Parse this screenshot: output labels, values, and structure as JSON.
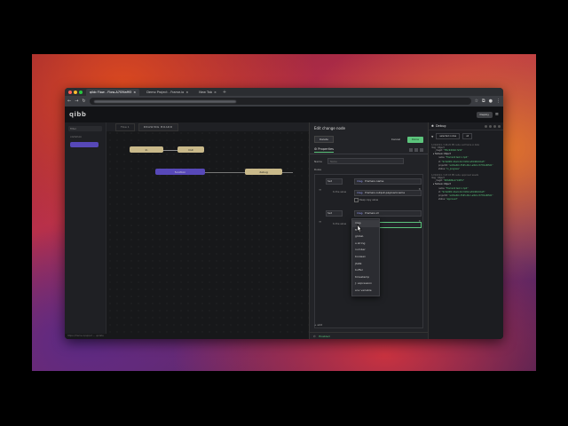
{
  "browser": {
    "tabs": [
      {
        "title": "qibb Flow - Flow-A7S9laf93",
        "active": true
      },
      {
        "title": "Demo Project - Frame.io",
        "active": false
      },
      {
        "title": "New Tab",
        "active": false
      }
    ],
    "new_tab": "+",
    "url": "",
    "traffic_lights": [
      "#ff5f57",
      "#febc2e",
      "#28c840"
    ]
  },
  "app": {
    "logo": "qibb",
    "deploy_label": "Deploy",
    "menu_icon": "hamburger-icon"
  },
  "palette": {
    "search_placeholder": "filter",
    "category": "common"
  },
  "workspace": {
    "tabs": [
      "Flow 1",
      "DRAWING BOARD"
    ],
    "nodes": [
      {
        "label": "In"
      },
      {
        "label": "Out"
      },
      {
        "label": "function"
      },
      {
        "label": "debug"
      }
    ],
    "status": "https://frame.io/api/v2 ... update"
  },
  "editor": {
    "title": "Edit change node",
    "delete_label": "Delete",
    "cancel_label": "Cancel",
    "done_label": "Done",
    "properties_tab": "Properties",
    "name_label": "Name",
    "name_placeholder": "Name",
    "rules_label": "Rules",
    "rules": [
      {
        "action": "Set",
        "property_prefix": "msg.",
        "property": "frameio.name",
        "to_label": "to the value",
        "value_prefix": "msg.",
        "value": "frameio.output.payload.name",
        "deep_copy_label": "Deep copy value"
      },
      {
        "action": "Set",
        "property_prefix": "msg.",
        "property": "frameio.id",
        "to_label": "to the value",
        "value_prefix": "a-z",
        "value": ""
      }
    ],
    "type_options": [
      "msg.",
      "flow.",
      "global.",
      "a string",
      "number",
      "boolean",
      "JSON",
      "buffer",
      "timestamp",
      "J: expression",
      "env variable"
    ],
    "hover_option_index": 0,
    "add_label": "+ add",
    "enabled_label": "Enabled"
  },
  "debug": {
    "title": "Debug",
    "filter_label": "selected nodes",
    "clear_label": "all",
    "messages": [
      {
        "meta": "1/22/2024, 3:46:20 PM  node: set frame.io data",
        "path": "msg : Object",
        "fields": [
          {
            "k": "_msgid",
            "v": "\"f3bc9d04b17a5b\""
          },
          {
            "k": "frameio",
            "v": "Object",
            "obj": true
          },
          {
            "k": "name",
            "v": "\"Frame10 test 1.mp4\""
          },
          {
            "k": "id",
            "v": "\"9c3e908c-4be9-41cf-9dbd-a8146b2cba5\""
          },
          {
            "k": "projectId",
            "v": "\"ea5be60c-5565-46cc-a0b0-c57f22af6561\""
          },
          {
            "k": "status",
            "v": "\"in_progress\""
          }
        ]
      },
      {
        "meta": "1/22/2024, 3:47:03 PM  node: approved assets",
        "path": "msg : Object",
        "fields": [
          {
            "k": "_msgid",
            "v": "\"60fe686a171d651\""
          },
          {
            "k": "frameio",
            "v": "Object",
            "obj": true
          },
          {
            "k": "name",
            "v": "\"Frame10 test 1.mp4\""
          },
          {
            "k": "id",
            "v": "\"9c3e908c-4be9-41cf-9dbd-a8146b2cba5\""
          },
          {
            "k": "projectId",
            "v": "\"ea5be60c-5565-46cc-a0b0-c57f22af6561\""
          },
          {
            "k": "status",
            "v": "\"approved\""
          }
        ]
      }
    ]
  },
  "colors": {
    "accent": "#5cc47c",
    "node_purple": "#5748b8",
    "node_tan": "#c9b98a"
  }
}
